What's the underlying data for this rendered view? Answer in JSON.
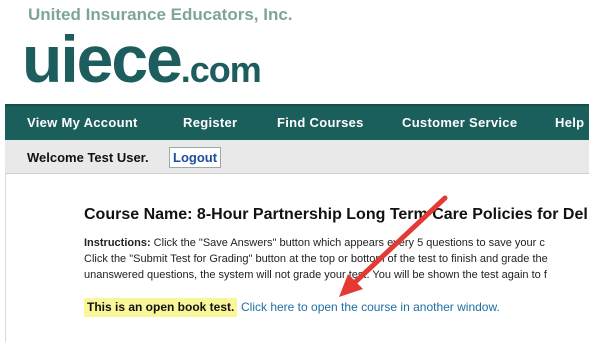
{
  "header": {
    "company_name": "United Insurance Educators, Inc.",
    "logo_main": "uiece",
    "logo_suffix": ".com"
  },
  "nav": {
    "items": [
      {
        "label": "View  My  Account"
      },
      {
        "label": "Register"
      },
      {
        "label": "Find  Courses"
      },
      {
        "label": "Customer  Service"
      },
      {
        "label": "Help"
      }
    ]
  },
  "welcome": {
    "text": "Welcome Test User.",
    "logout_label": "Logout"
  },
  "course": {
    "title": "Course Name: 8-Hour Partnership Long Term Care Policies for Del",
    "instructions_label": "Instructions:",
    "instructions_line1": " Click the \"Save Answers\" button which appears every 5 questions to save your c",
    "instructions_line2": "Click the \"Submit Test for Grading\" button at the top or bottom of the test to finish and grade the",
    "instructions_line3": "unanswered questions, the system will not grade your test. You will be shown the test again to f",
    "open_book_text": "This is an open book test.",
    "course_link_text": "Click here to open the course in another window."
  },
  "colors": {
    "nav_bg": "#1b5f5c",
    "logo": "#1d5d5d",
    "company_name": "#7fa597",
    "highlight": "#faf79a",
    "link": "#1e6fa5",
    "annotation_arrow": "#e53935"
  }
}
